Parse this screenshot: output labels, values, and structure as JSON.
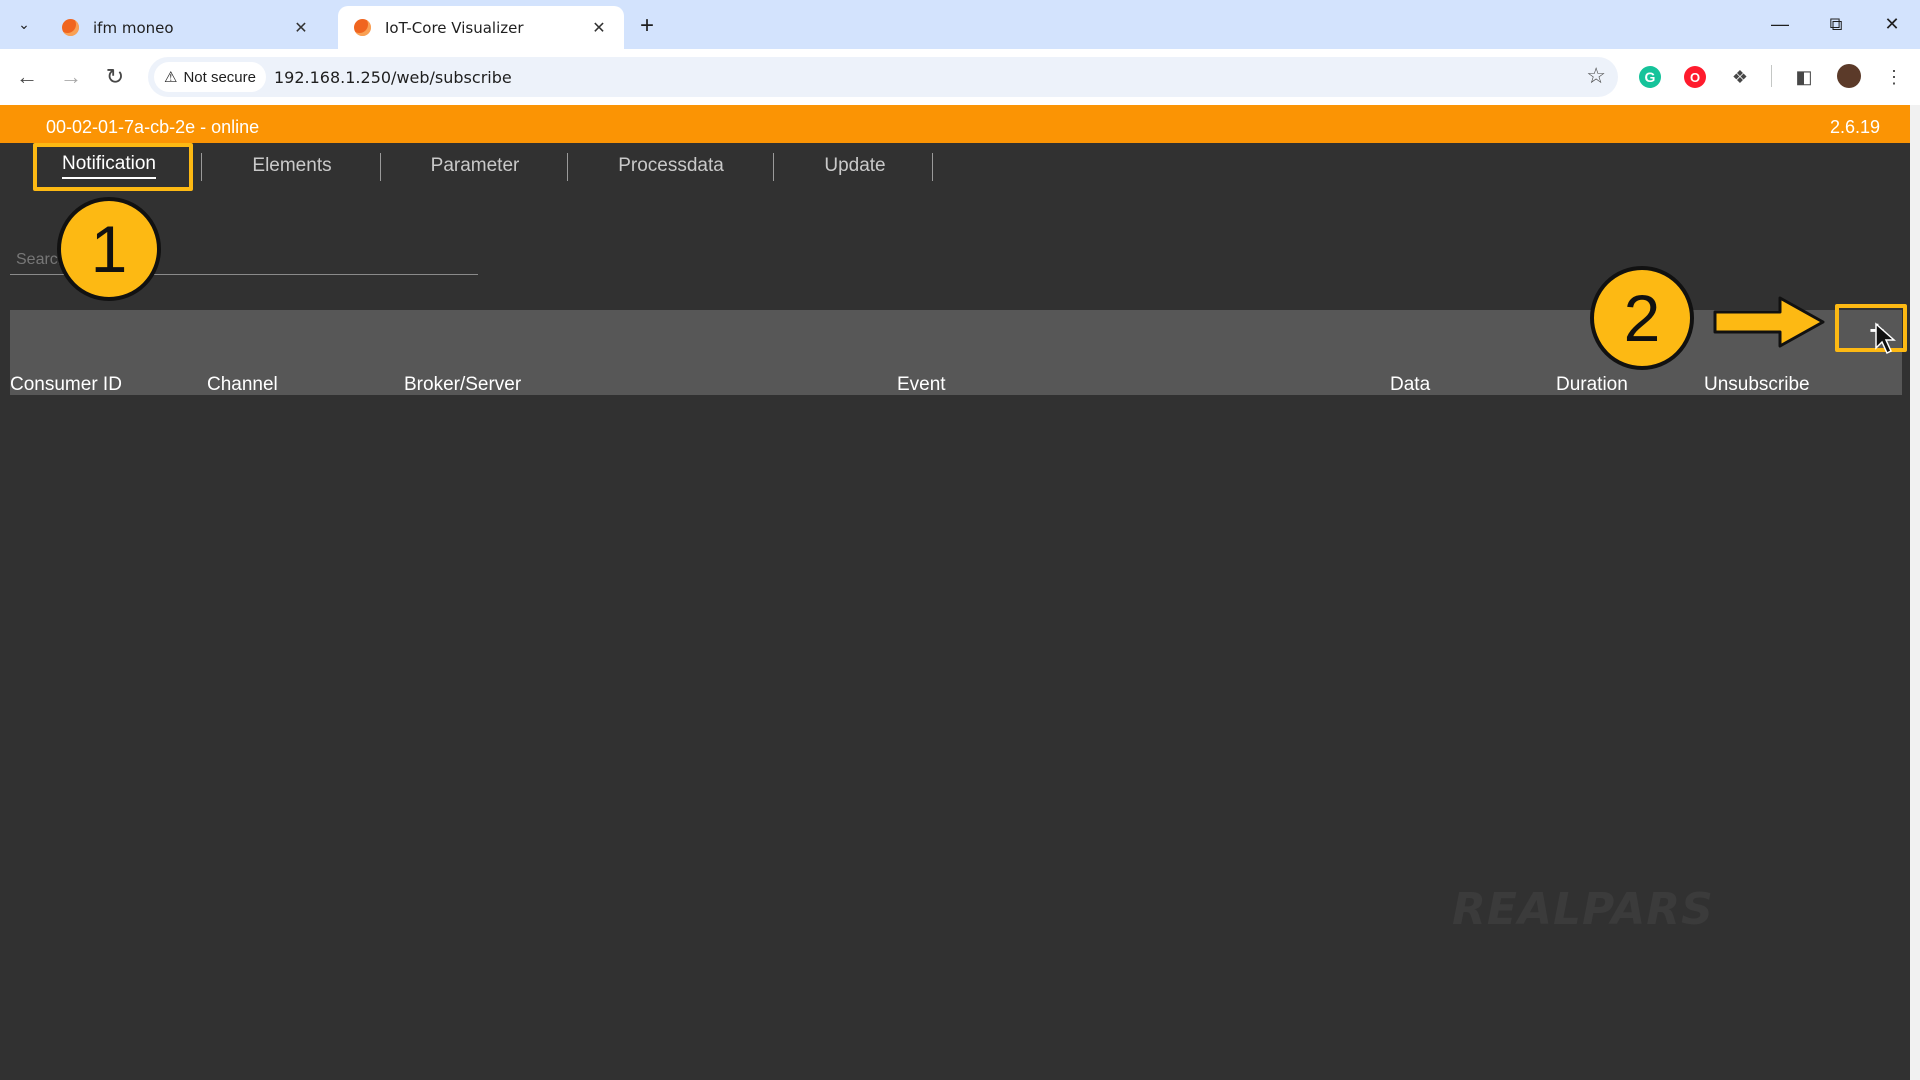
{
  "browser": {
    "tabs": [
      {
        "title": "ifm moneo",
        "active": false
      },
      {
        "title": "IoT-Core Visualizer",
        "active": true
      }
    ],
    "address": {
      "security_label": "Not secure",
      "url": "192.168.1.250/web/subscribe"
    },
    "icons": {
      "tab_search": "chevron-down-icon",
      "new_tab": "plus-icon",
      "back": "arrow-left-icon",
      "forward": "arrow-right-icon",
      "reload": "reload-icon",
      "bookmark": "star-icon",
      "extensions": "puzzle-icon",
      "side_panel": "side-panel-icon",
      "menu": "kebab-icon"
    },
    "colors": {
      "tabstrip": "#d3e3fd",
      "omnibox": "#edf2fa"
    }
  },
  "app": {
    "device_status": "00-02-01-7a-cb-2e - online",
    "version": "2.6.19",
    "nav_tabs": [
      {
        "label": "Notification",
        "selected": true
      },
      {
        "label": "Elements",
        "selected": false
      },
      {
        "label": "Parameter",
        "selected": false
      },
      {
        "label": "Processdata",
        "selected": false
      },
      {
        "label": "Update",
        "selected": false
      }
    ],
    "search": {
      "placeholder": "Search"
    },
    "table": {
      "columns": [
        "Consumer ID",
        "Channel",
        "Broker/Server",
        "Event",
        "Data",
        "Duration",
        "Unsubscribe"
      ],
      "add_label": "+"
    },
    "colors": {
      "header": "#fb9404",
      "background": "#313131",
      "table_band": "#575757"
    }
  },
  "annotations": {
    "markers": [
      "1",
      "2"
    ],
    "highlight_color": "#fdb913"
  },
  "watermark": "REALPARS"
}
